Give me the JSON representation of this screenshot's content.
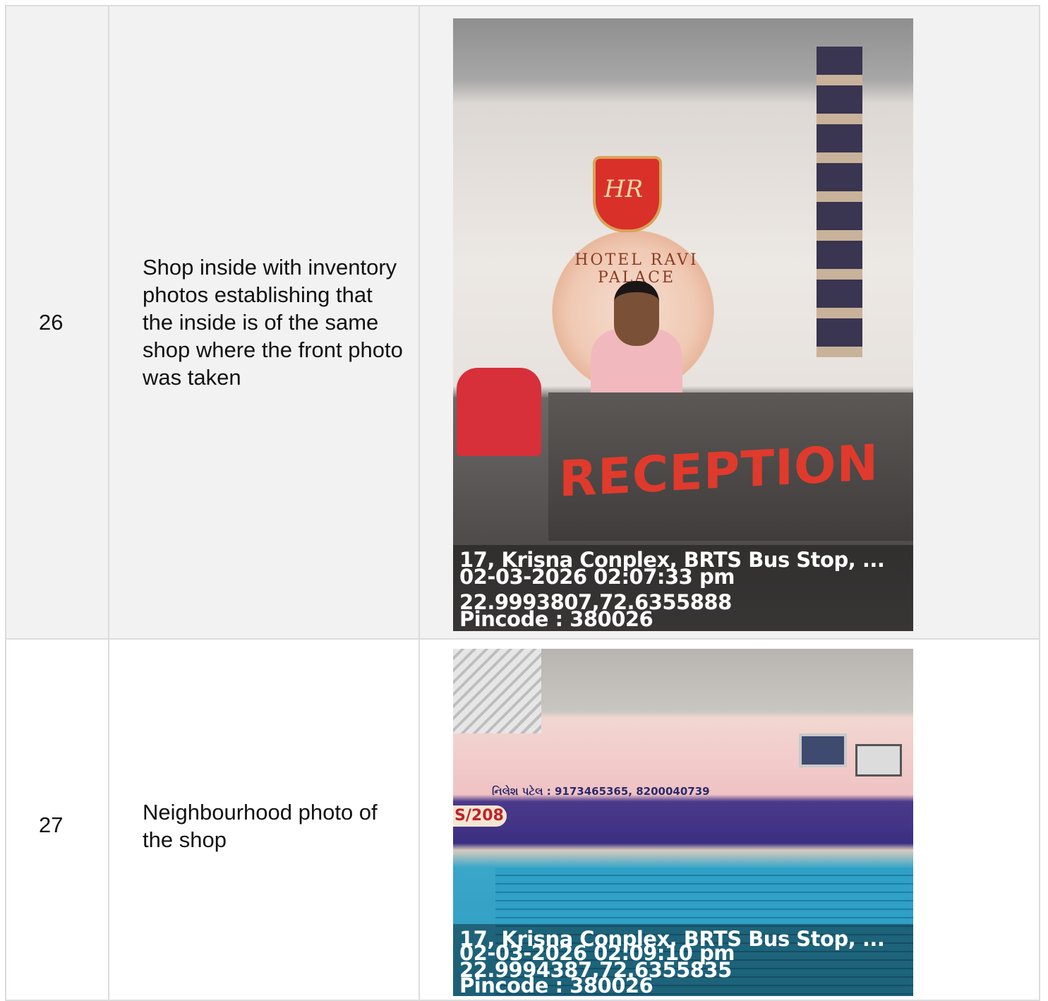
{
  "rows": [
    {
      "number": "26",
      "description": "Shop inside with inventory photos establishing that the inside is of the same shop where the front photo was taken",
      "photo": {
        "subject": "hotel-reception-interior",
        "sign_text": "RECEPTION",
        "logo_text": "HOTEL RAVI PALACE",
        "logo_mark": "HR",
        "caption": {
          "address": "17, Krisna Conplex, BRTS Bus Stop, ...",
          "datetime": "02-03-2026 02:07:33 pm",
          "coordinates": "22.9993807,72.6355888",
          "pincode": "Pincode : 380026"
        }
      }
    },
    {
      "number": "27",
      "description": "Neighbourhood photo of the shop",
      "photo": {
        "subject": "computer-shop-signboard",
        "sign_phone": "નિલેશ પટેલ : 9173465365, 8200040739",
        "shop_no": "S/208",
        "caption": {
          "address": "17, Krisna Conplex, BRTS Bus Stop, ...",
          "datetime": "02-03-2026 02:09:10 pm",
          "coordinates": "22.9994387,72.6355835",
          "pincode": "Pincode : 380026"
        }
      }
    }
  ],
  "colors": {
    "border": "#dcdcdc",
    "row_alt": "#f2f2f2",
    "caption_text": "#ffffff",
    "sign_red": "#e03a2c"
  }
}
